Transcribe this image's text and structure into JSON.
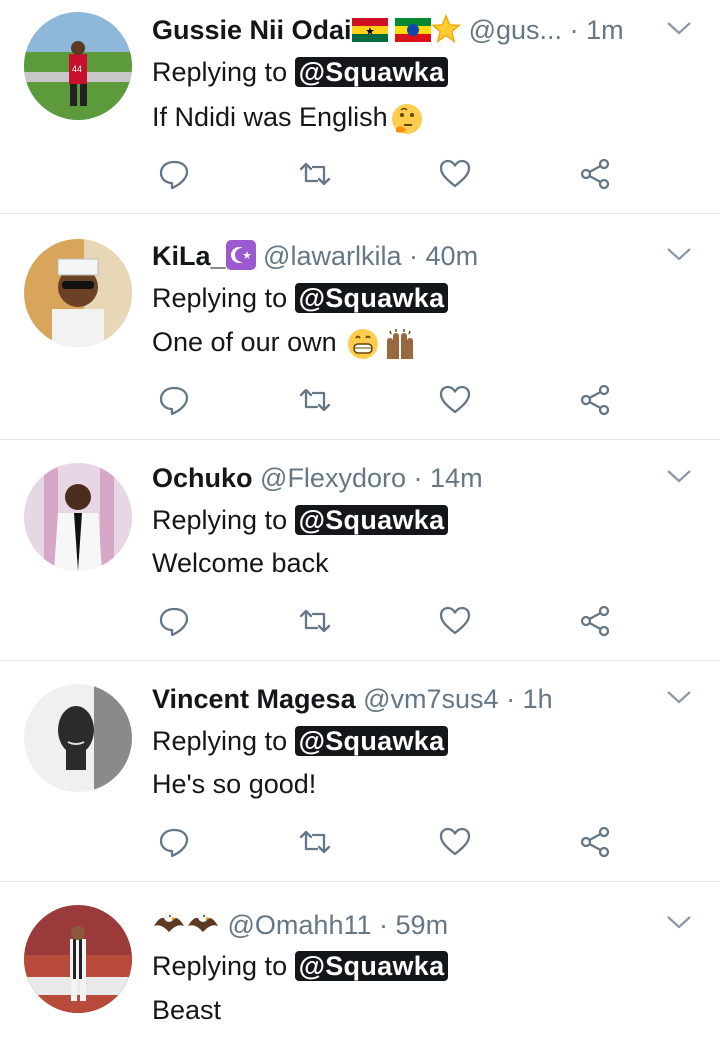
{
  "replying_to_label": "Replying to",
  "tweets": [
    {
      "name": "Gussie Nii Odai",
      "handle": "@gus...",
      "dot": "·",
      "time": "1m",
      "mention": "@Squawka",
      "text": "If Ndidi was English",
      "emoji": [
        "flag-ghana",
        "flag-ethiopia",
        "star",
        "thinking-face"
      ]
    },
    {
      "name": "KiLa_",
      "handle": "@lawarlkila",
      "dot": "·",
      "time": "40m",
      "mention": "@Squawka",
      "text": "One of our own",
      "emoji": [
        "crescent-star",
        "grinning-face",
        "raising-hands"
      ]
    },
    {
      "name": "Ochuko",
      "handle": "@Flexydoro",
      "dot": "·",
      "time": "14m",
      "mention": "@Squawka",
      "text": "Welcome back",
      "emoji": []
    },
    {
      "name": "Vincent Magesa",
      "handle": "@vm7sus4",
      "dot": "·",
      "time": "1h",
      "mention": "@Squawka",
      "text": "He's so good!",
      "emoji": []
    },
    {
      "name": "",
      "handle": "@Omahh11",
      "dot": "·",
      "time": "59m",
      "mention": "@Squawka",
      "text": "Beast",
      "emoji": [
        "eagle",
        "eagle"
      ]
    }
  ],
  "icons": {
    "reply": "reply-icon",
    "retweet": "retweet-icon",
    "like": "like-icon",
    "share": "share-icon",
    "menu": "chevron-down-icon"
  },
  "colors": {
    "text": "#14171a",
    "secondary": "#657786",
    "divider": "#e1e8ed",
    "mention_bg": "#14171a",
    "action_icon": "#657786"
  }
}
